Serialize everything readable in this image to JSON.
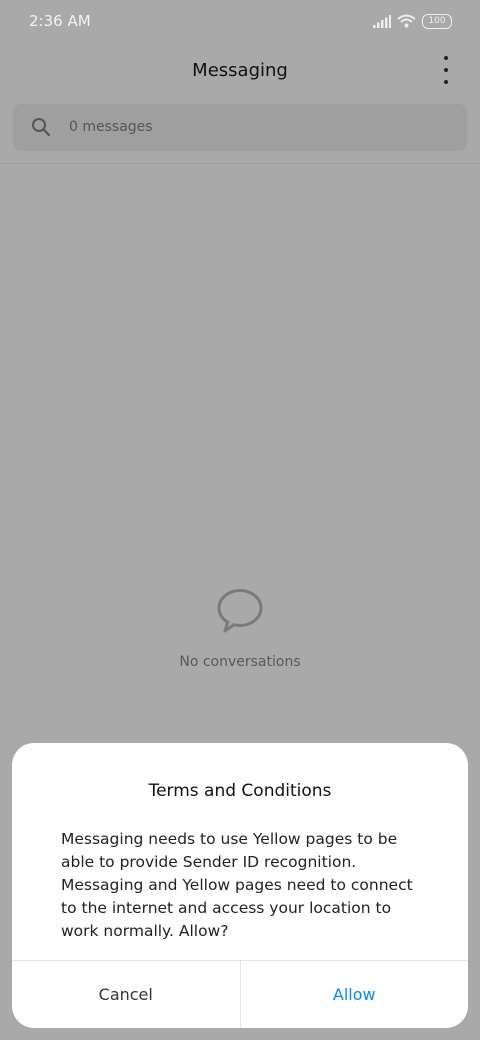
{
  "status_bar": {
    "time": "2:36 AM",
    "battery": "100",
    "icons": [
      "signal-icon",
      "wifi-icon",
      "battery-icon"
    ]
  },
  "app_bar": {
    "title": "Messaging",
    "menu_icon": "more-vertical-icon"
  },
  "search": {
    "icon": "search-icon",
    "text": "0 messages"
  },
  "empty_state": {
    "icon": "chat-bubble-icon",
    "text": "No conversations"
  },
  "dialog": {
    "title": "Terms and Conditions",
    "message": "Messaging needs to use Yellow pages to be able to provide Sender ID recognition. Messaging and Yellow pages need to connect to the internet and access your location to work normally. Allow?",
    "cancel_label": "Cancel",
    "allow_label": "Allow"
  },
  "colors": {
    "scrim_background": "#a9a9a9",
    "accent": "#0a8ae6",
    "dialog_background": "#ffffff"
  }
}
